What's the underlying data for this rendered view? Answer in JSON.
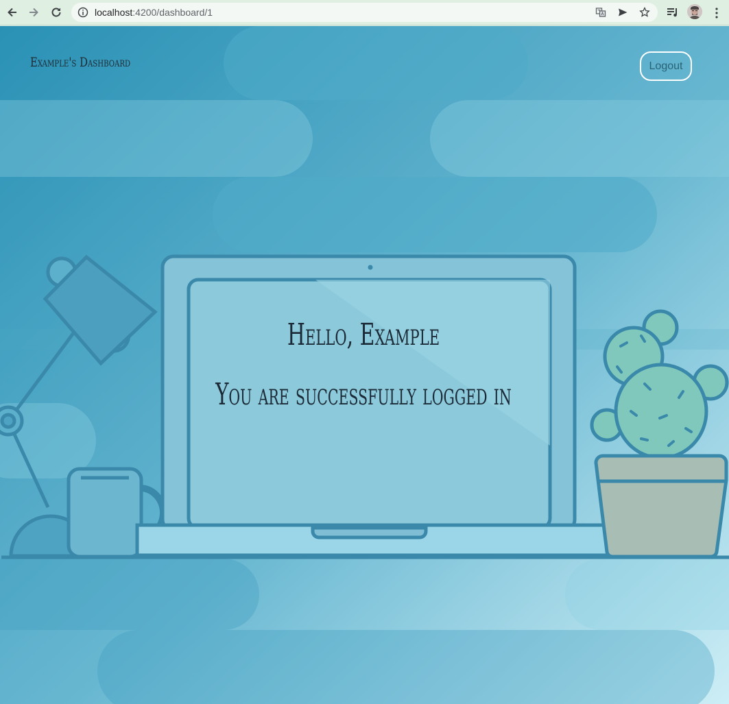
{
  "browser": {
    "url_host": "localhost",
    "url_rest": ":4200/dashboard/1"
  },
  "header": {
    "brand": "Example's Dashboard",
    "logout_label": "Logout"
  },
  "main": {
    "greeting": "Hello, Example",
    "message": "You are successfully logged in"
  },
  "colors": {
    "bg_dark": "#2f93b6",
    "bg_light": "#c9ecf4",
    "outline": "#3a88aa",
    "cactus": "#7fc8bb",
    "pot": "#a8bdb3"
  }
}
